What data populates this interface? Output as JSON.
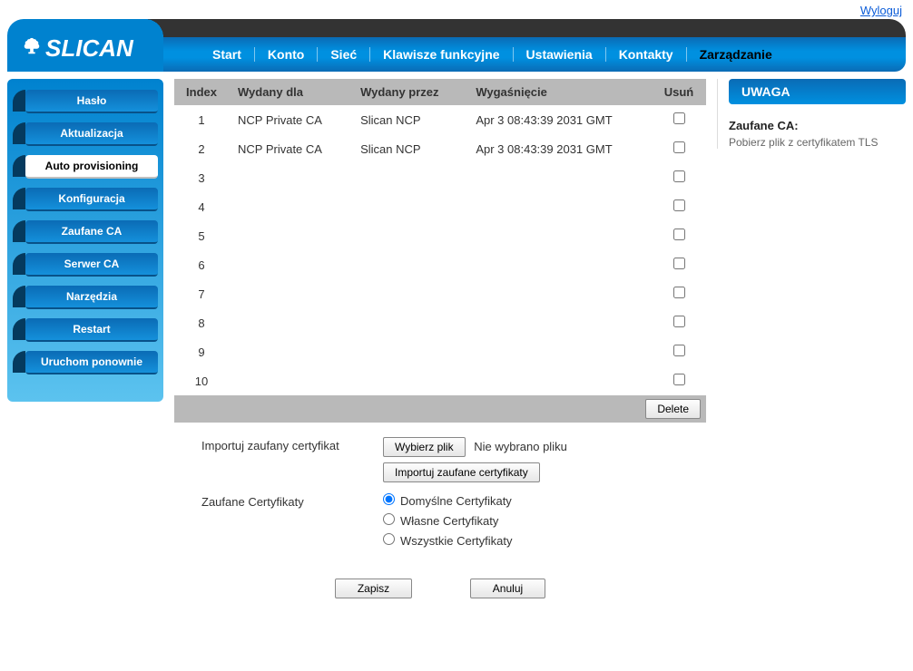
{
  "logout": "Wyloguj",
  "brand": "SLICAN",
  "nav": {
    "items": [
      "Start",
      "Konto",
      "Sieć",
      "Klawisze funkcyjne",
      "Ustawienia",
      "Kontakty",
      "Zarządzanie"
    ],
    "active_index": 6
  },
  "sidebar": {
    "items": [
      "Hasło",
      "Aktualizacja",
      "Auto provisioning",
      "Konfiguracja",
      "Zaufane CA",
      "Serwer CA",
      "Narzędzia",
      "Restart",
      "Uruchom ponownie"
    ],
    "active_index": 2
  },
  "table": {
    "headers": {
      "index": "Index",
      "issued_for": "Wydany dla",
      "issued_by": "Wydany przez",
      "expiration": "Wygaśnięcie",
      "delete": "Usuń"
    },
    "rows": [
      {
        "index": "1",
        "issued_for": "NCP Private CA",
        "issued_by": "Slican NCP",
        "expiration": "Apr 3 08:43:39 2031 GMT"
      },
      {
        "index": "2",
        "issued_for": "NCP Private CA",
        "issued_by": "Slican NCP",
        "expiration": "Apr 3 08:43:39 2031 GMT"
      },
      {
        "index": "3",
        "issued_for": "",
        "issued_by": "",
        "expiration": ""
      },
      {
        "index": "4",
        "issued_for": "",
        "issued_by": "",
        "expiration": ""
      },
      {
        "index": "5",
        "issued_for": "",
        "issued_by": "",
        "expiration": ""
      },
      {
        "index": "6",
        "issued_for": "",
        "issued_by": "",
        "expiration": ""
      },
      {
        "index": "7",
        "issued_for": "",
        "issued_by": "",
        "expiration": ""
      },
      {
        "index": "8",
        "issued_for": "",
        "issued_by": "",
        "expiration": ""
      },
      {
        "index": "9",
        "issued_for": "",
        "issued_by": "",
        "expiration": ""
      },
      {
        "index": "10",
        "issued_for": "",
        "issued_by": "",
        "expiration": ""
      }
    ],
    "delete_btn": "Delete"
  },
  "form": {
    "import_label": "Importuj zaufany certyfikat",
    "choose_file_btn": "Wybierz plik",
    "no_file_txt": "Nie wybrano pliku",
    "import_btn": "Importuj zaufane certyfikaty",
    "trusted_label": "Zaufane Certyfikaty",
    "radio_options": [
      "Domyślne Certyfikaty",
      "Własne Certyfikaty",
      "Wszystkie Certyfikaty"
    ],
    "radio_selected_index": 0,
    "save_btn": "Zapisz",
    "cancel_btn": "Anuluj"
  },
  "help": {
    "header": "UWAGA",
    "title": "Zaufane CA:",
    "text": "Pobierz plik z certyfikatem TLS"
  }
}
